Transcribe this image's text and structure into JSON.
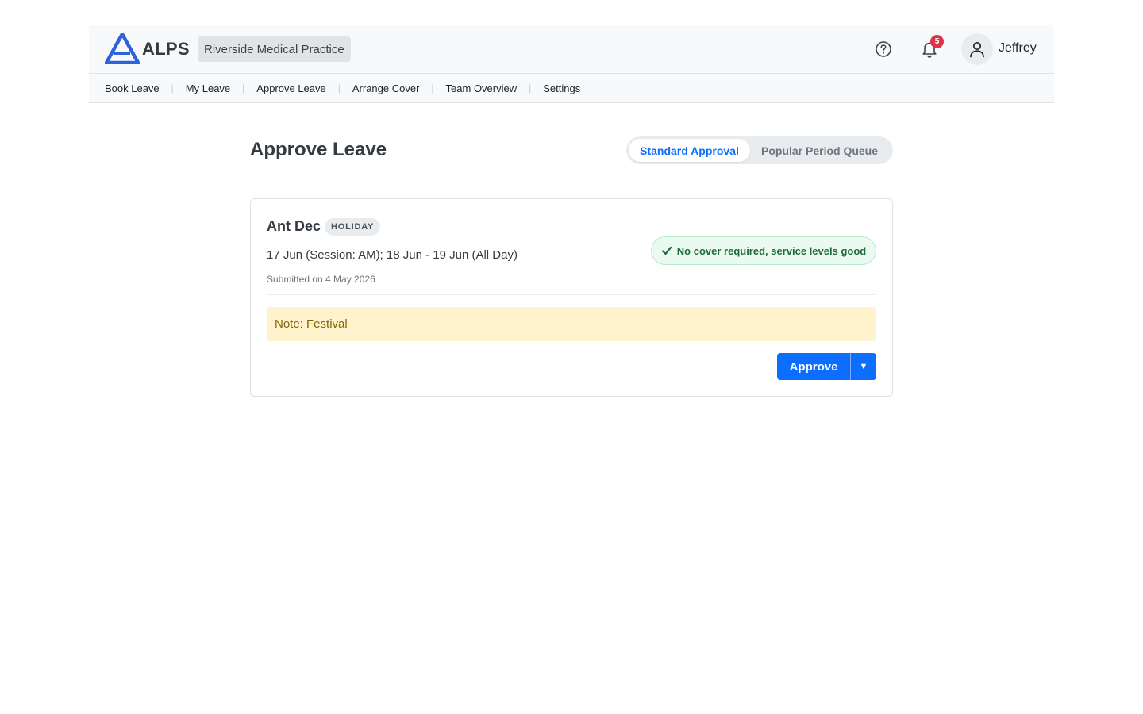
{
  "header": {
    "logo_text": "ALPS",
    "practice_name": "Riverside Medical Practice",
    "help_icon": "question-circle-icon",
    "notifications_icon": "bell-icon",
    "notification_count": "5",
    "avatar_icon": "person-icon",
    "user_name": "Jeffrey"
  },
  "nav": {
    "items": [
      "Book Leave",
      "My Leave",
      "Approve Leave",
      "Arrange Cover",
      "Team Overview",
      "Settings"
    ],
    "separator": "|"
  },
  "page": {
    "title": "Approve Leave",
    "toggle": {
      "active_label": "Standard Approval",
      "inactive_label": "Popular Period Queue"
    }
  },
  "request": {
    "employee_name": "Ant Dec",
    "leave_type": "HOLIDAY",
    "dates": "17 Jun (Session: AM); 18 Jun - 19 Jun (All Day)",
    "submitted": "Submitted on 4 May 2026",
    "cover_status": "No cover required, service levels good",
    "cover_icon": "checkmark-icon",
    "note": "Note: Festival",
    "approve_label": "Approve",
    "dropdown_symbol": "▼"
  },
  "colors": {
    "primary": "#0d6efd",
    "brand": "#2f62d8",
    "success_text": "#1e6b3b",
    "note_bg": "#fff3cd",
    "badge_red": "#dc3545"
  }
}
